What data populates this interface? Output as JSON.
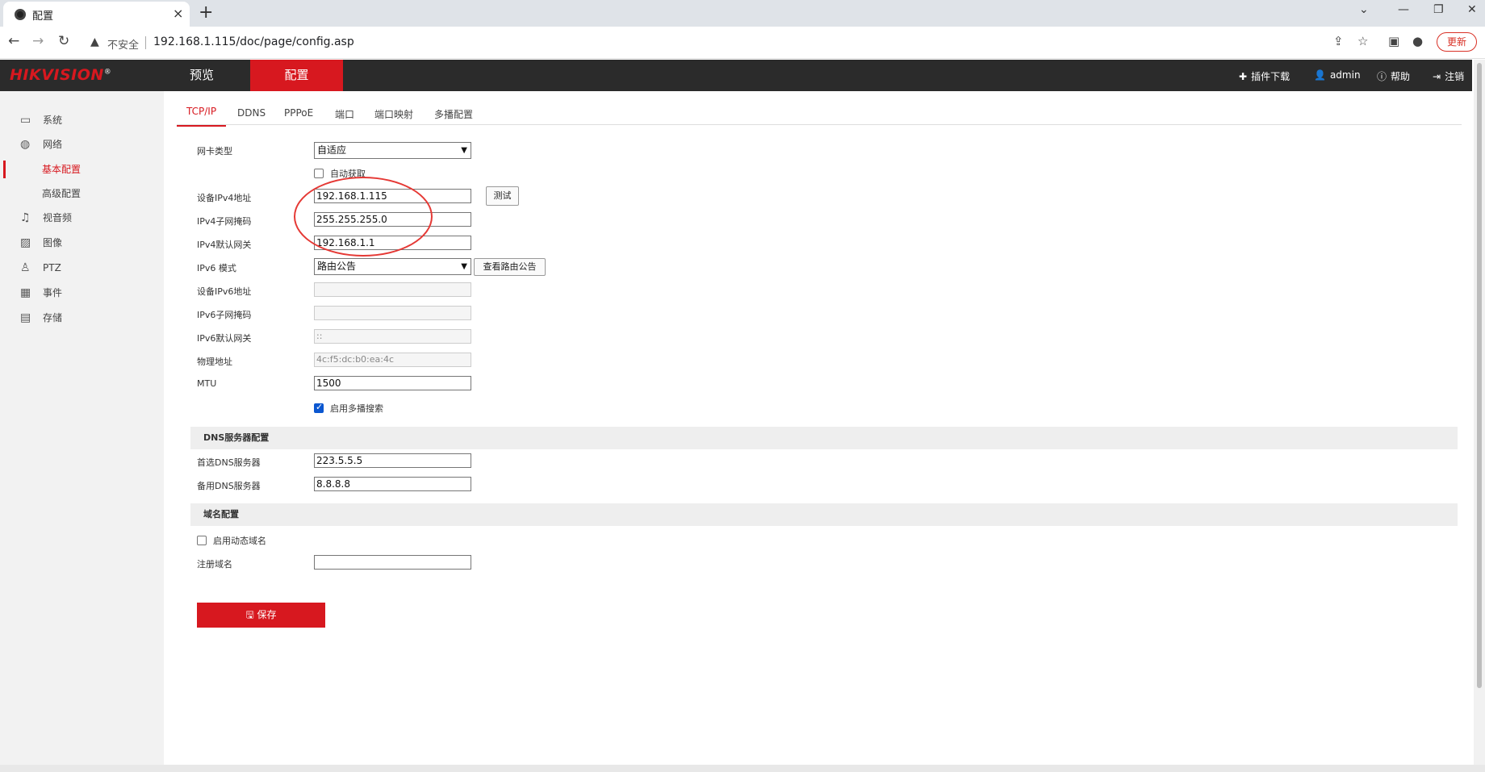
{
  "browser": {
    "tab_title": "配置",
    "new_tab": "+",
    "insecure_label": "不安全",
    "url": "192.168.1.115/doc/page/config.asp",
    "update_label": "更新"
  },
  "app": {
    "logo": "HIKVISION",
    "logo_mark": "®",
    "nav": [
      {
        "label": "预览"
      },
      {
        "label": "配置"
      }
    ],
    "plugin_label": "插件下载",
    "user_label": "admin",
    "help_label": "帮助",
    "logout_label": "注销"
  },
  "sidebar": {
    "items": [
      {
        "label": "系统",
        "icon": "monitor-icon"
      },
      {
        "label": "网络",
        "icon": "globe-icon"
      },
      {
        "label": "基本配置",
        "icon": ""
      },
      {
        "label": "高级配置",
        "icon": ""
      },
      {
        "label": "视音频",
        "icon": "mic-icon"
      },
      {
        "label": "图像",
        "icon": "image-icon"
      },
      {
        "label": "PTZ",
        "icon": "ptz-icon"
      },
      {
        "label": "事件",
        "icon": "calendar-icon"
      },
      {
        "label": "存储",
        "icon": "disk-icon"
      }
    ]
  },
  "tabs": [
    {
      "label": "TCP/IP"
    },
    {
      "label": "DDNS"
    },
    {
      "label": "PPPoE"
    },
    {
      "label": "端口"
    },
    {
      "label": "端口映射"
    },
    {
      "label": "多播配置"
    }
  ],
  "form": {
    "nic_type_label": "网卡类型",
    "nic_type_value": "自适应",
    "dhcp_label": "自动获取",
    "ipv4_addr_label": "设备IPv4地址",
    "ipv4_addr_value": "192.168.1.115",
    "test_button": "测试",
    "ipv4_mask_label": "IPv4子网掩码",
    "ipv4_mask_value": "255.255.255.0",
    "ipv4_gw_label": "IPv4默认网关",
    "ipv4_gw_value": "192.168.1.1",
    "ipv6_mode_label": "IPv6 模式",
    "ipv6_mode_value": "路由公告",
    "view_ra_button": "查看路由公告",
    "ipv6_addr_label": "设备IPv6地址",
    "ipv6_addr_value": "",
    "ipv6_mask_label": "IPv6子网掩码",
    "ipv6_mask_value": "",
    "ipv6_gw_label": "IPv6默认网关",
    "ipv6_gw_value": "::",
    "mac_label": "物理地址",
    "mac_value": "4c:f5:dc:b0:ea:4c",
    "mtu_label": "MTU",
    "mtu_value": "1500",
    "multicast_label": "启用多播搜索",
    "dns_section": "DNS服务器配置",
    "dns1_label": "首选DNS服务器",
    "dns1_value": "223.5.5.5",
    "dns2_label": "备用DNS服务器",
    "dns2_value": "8.8.8.8",
    "domain_section": "域名配置",
    "ddns_enable_label": "启用动态域名",
    "reg_domain_label": "注册域名",
    "reg_domain_value": "",
    "save_button": "保存"
  },
  "colors": {
    "brand_red": "#d7181f",
    "header_bg": "#2b2b2b",
    "annotation": "#e53935"
  }
}
